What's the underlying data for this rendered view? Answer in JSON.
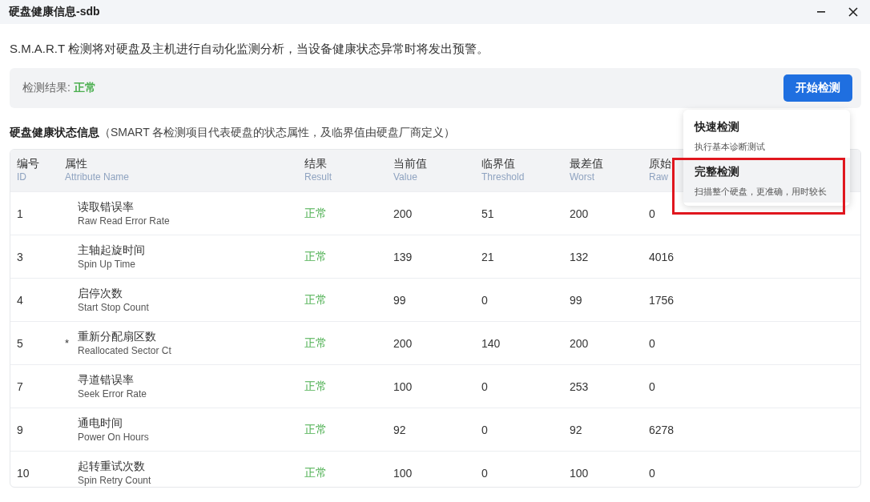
{
  "window": {
    "title": "硬盘健康信息-sdb",
    "controls": [
      {
        "kind": "minimize"
      },
      {
        "kind": "close"
      }
    ]
  },
  "description": "S.M.A.R.T 检测将对硬盘及主机进行自动化监测分析，当设备健康状态异常时将发出预警。",
  "status": {
    "label": "检测结果:",
    "value": "正常",
    "ok": true
  },
  "start_button": "开始检测",
  "menu": [
    {
      "title": "快速检测",
      "subtitle": "执行基本诊断测试",
      "selected": false,
      "highlighted": false
    },
    {
      "title": "完整检测",
      "subtitle": "扫描整个硬盘，更准确，用时较长",
      "selected": true,
      "highlighted": true
    }
  ],
  "section": {
    "title": "硬盘健康状态信息",
    "note": "（SMART 各检测项目代表硬盘的状态属性，及临界值由硬盘厂商定义）"
  },
  "table": {
    "columns": [
      {
        "zh": "编号",
        "en": "ID"
      },
      {
        "zh": "属性",
        "en": "Attribute Name"
      },
      {
        "zh": "结果",
        "en": "Result"
      },
      {
        "zh": "当前值",
        "en": "Value"
      },
      {
        "zh": "临界值",
        "en": "Threshold"
      },
      {
        "zh": "最差值",
        "en": "Worst"
      },
      {
        "zh": "原始",
        "en": "Raw"
      }
    ],
    "rows": [
      {
        "id": "1",
        "zh": "读取错误率",
        "en": "Raw Read Error Rate",
        "critical": false,
        "result": "正常",
        "ok": true,
        "value": "200",
        "threshold": "51",
        "worst": "200",
        "raw": "0"
      },
      {
        "id": "3",
        "zh": "主轴起旋时间",
        "en": "Spin Up Time",
        "critical": false,
        "result": "正常",
        "ok": true,
        "value": "139",
        "threshold": "21",
        "worst": "132",
        "raw": "4016"
      },
      {
        "id": "4",
        "zh": "启停次数",
        "en": "Start Stop Count",
        "critical": false,
        "result": "正常",
        "ok": true,
        "value": "99",
        "threshold": "0",
        "worst": "99",
        "raw": "1756"
      },
      {
        "id": "5",
        "zh": "重新分配扇区数",
        "en": "Reallocated Sector Ct",
        "critical": true,
        "mark": "*",
        "result": "正常",
        "ok": true,
        "value": "200",
        "threshold": "140",
        "worst": "200",
        "raw": "0"
      },
      {
        "id": "7",
        "zh": "寻道错误率",
        "en": "Seek Error Rate",
        "critical": false,
        "result": "正常",
        "ok": true,
        "value": "100",
        "threshold": "0",
        "worst": "253",
        "raw": "0"
      },
      {
        "id": "9",
        "zh": "通电时间",
        "en": "Power On Hours",
        "critical": false,
        "result": "正常",
        "ok": true,
        "value": "92",
        "threshold": "0",
        "worst": "92",
        "raw": "6278"
      },
      {
        "id": "10",
        "zh": "起转重试次数",
        "en": "Spin Retry Count",
        "critical": false,
        "result": "正常",
        "ok": true,
        "value": "100",
        "threshold": "0",
        "worst": "100",
        "raw": "0"
      }
    ]
  }
}
